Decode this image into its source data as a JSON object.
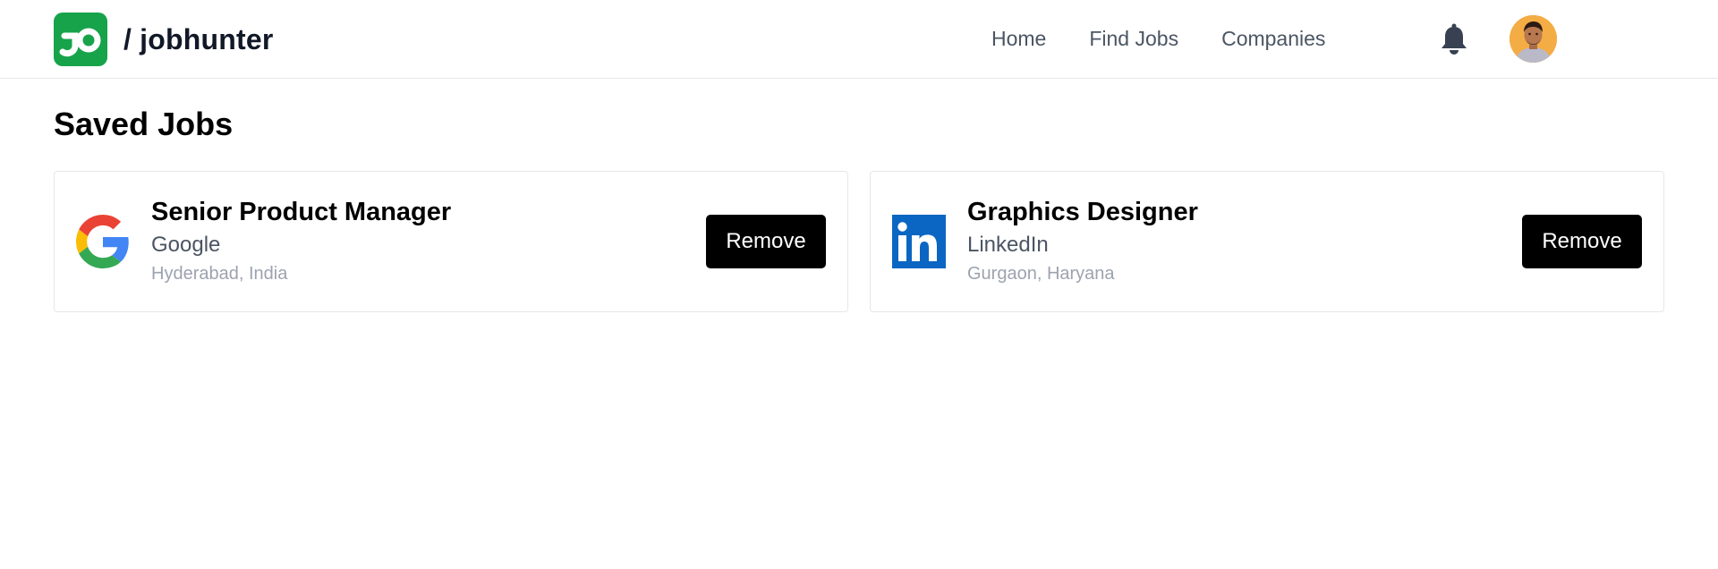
{
  "header": {
    "brand": "/ jobhunter",
    "nav": [
      "Home",
      "Find Jobs",
      "Companies"
    ]
  },
  "main": {
    "title": "Saved Jobs",
    "jobs": [
      {
        "title": "Senior Product Manager",
        "company": "Google",
        "location": "Hyderabad, India",
        "logo_icon": "google-icon",
        "action_label": "Remove"
      },
      {
        "title": "Graphics Designer",
        "company": "LinkedIn",
        "location": "Gurgaon, Haryana",
        "logo_icon": "linkedin-icon",
        "action_label": "Remove"
      }
    ]
  },
  "colors": {
    "brand_green": "#16a34a",
    "linkedin_blue": "#0a66c2",
    "button_bg": "#000000"
  }
}
